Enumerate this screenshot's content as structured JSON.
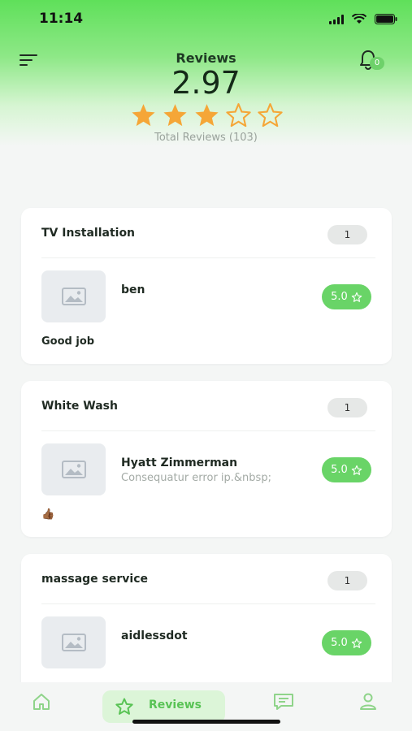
{
  "status": {
    "time": "11:14"
  },
  "header": {
    "title": "Reviews",
    "rating": "2.97",
    "rating_value": 2.97,
    "stars_max": 5,
    "total": "Total Reviews (103)",
    "notifications": "0"
  },
  "reviews": [
    {
      "service": "TV Installation",
      "count": "1",
      "user": "ben",
      "subtitle": "",
      "rating": "5.0",
      "comment": "Good job"
    },
    {
      "service": "White Wash",
      "count": "1",
      "user": "Hyatt Zimmerman",
      "subtitle": "Consequatur error ip.&nbsp;",
      "rating": "5.0",
      "comment": "👍🏾"
    },
    {
      "service": "massage service",
      "count": "1",
      "user": "aidlessdot",
      "subtitle": "",
      "rating": "5.0",
      "comment": ""
    }
  ],
  "nav": {
    "active": "Reviews",
    "items": [
      "home",
      "reviews",
      "messages",
      "profile"
    ]
  },
  "colors": {
    "accent": "#69d467",
    "star": "#f5a637",
    "nav_bg": "#dcf5d8"
  }
}
